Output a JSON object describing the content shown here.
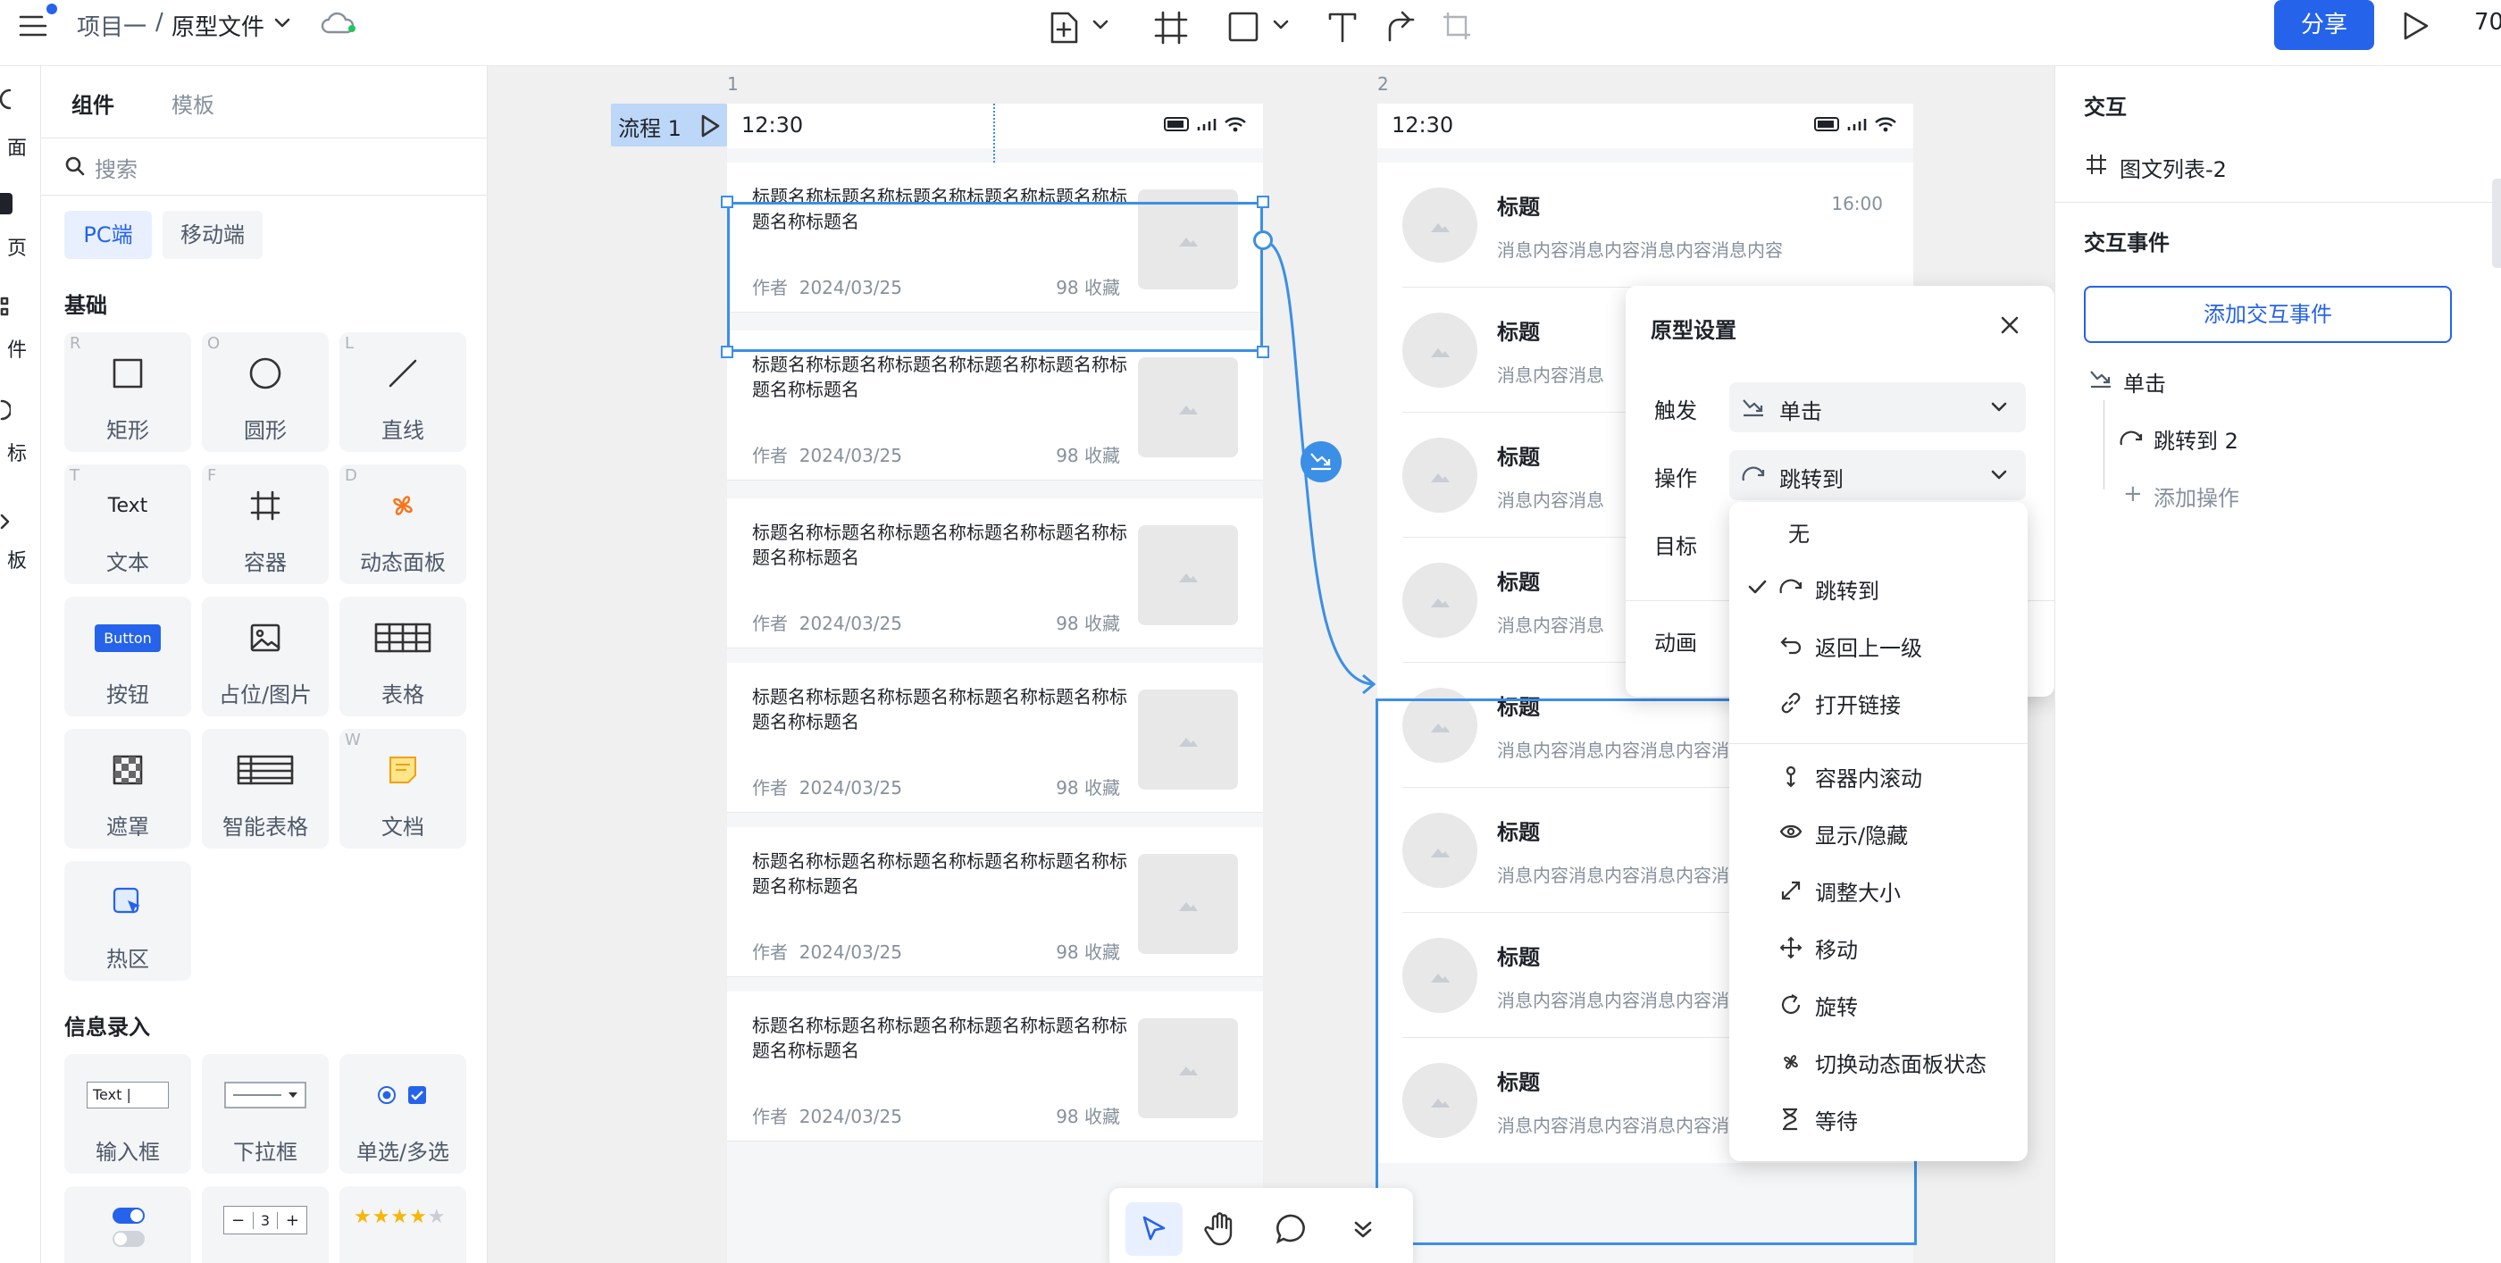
{
  "toolbar": {
    "project": "项目一",
    "separator": "/",
    "file_name": "原型文件",
    "share_label": "分享",
    "zoom": "70"
  },
  "rail": [
    "面",
    "页",
    "件",
    "标",
    "板"
  ],
  "left_panel": {
    "tabs": [
      "组件",
      "模板"
    ],
    "search_placeholder": "搜索",
    "platforms": [
      "PC端",
      "移动端"
    ],
    "section_basic": "基础",
    "basic": [
      {
        "key": "R",
        "label": "矩形",
        "icon": "rectangle-icon"
      },
      {
        "key": "O",
        "label": "圆形",
        "icon": "circle-icon"
      },
      {
        "key": "L",
        "label": "直线",
        "icon": "line-icon"
      },
      {
        "key": "T",
        "label": "文本",
        "glyph": "Text",
        "icon": "text-icon"
      },
      {
        "key": "F",
        "label": "容器",
        "icon": "frame-icon"
      },
      {
        "key": "D",
        "label": "动态面板",
        "icon": "pinwheel-icon"
      },
      {
        "key": "",
        "label": "按钮",
        "glyph": "Button",
        "icon": "button-icon"
      },
      {
        "key": "",
        "label": "占位/图片",
        "icon": "image-icon"
      },
      {
        "key": "",
        "label": "表格",
        "icon": "table-icon"
      },
      {
        "key": "",
        "label": "遮罩",
        "icon": "mask-icon"
      },
      {
        "key": "",
        "label": "智能表格",
        "icon": "smart-table-icon"
      },
      {
        "key": "W",
        "label": "文档",
        "icon": "document-icon"
      },
      {
        "key": "",
        "label": "热区",
        "icon": "hotspot-icon"
      }
    ],
    "section_input": "信息录入",
    "inputs": [
      {
        "label": "输入框",
        "glyph": "Text |"
      },
      {
        "label": "下拉框"
      },
      {
        "label": "单选/多选"
      }
    ],
    "stepper_value": "3"
  },
  "canvas": {
    "frame1_num": "1",
    "frame2_num": "2",
    "flow_label": "流程 1",
    "time": "12:30",
    "card_title": "标题名称标题名称标题名称标题名称标题名称标题名称标题名",
    "card_author": "作者",
    "card_date": "2024/03/25",
    "card_fav": "98 收藏",
    "msg_title": "标题",
    "msg_content": "消息内容消息内容消息内容消息内容",
    "msg_time": "16:00"
  },
  "proto": {
    "title": "原型设置",
    "trigger_label": "触发",
    "trigger_value": "单击",
    "action_label": "操作",
    "action_value": "跳转到",
    "target_label": "目标",
    "anim_label": "动画"
  },
  "menu": [
    {
      "label": "无",
      "icon": "",
      "checked": false
    },
    {
      "label": "跳转到",
      "icon": "jump-icon",
      "checked": true
    },
    {
      "label": "返回上一级",
      "icon": "back-icon",
      "checked": false
    },
    {
      "label": "打开链接",
      "icon": "link-icon",
      "checked": false
    },
    {
      "label": "容器内滚动",
      "icon": "scroll-icon",
      "checked": false
    },
    {
      "label": "显示/隐藏",
      "icon": "eye-icon",
      "checked": false
    },
    {
      "label": "调整大小",
      "icon": "resize-icon",
      "checked": false
    },
    {
      "label": "移动",
      "icon": "move-icon",
      "checked": false
    },
    {
      "label": "旋转",
      "icon": "rotate-icon",
      "checked": false
    },
    {
      "label": "切换动态面板状态",
      "icon": "pinwheel-icon",
      "checked": false
    },
    {
      "label": "等待",
      "icon": "hourglass-icon",
      "checked": false
    }
  ],
  "right_panel": {
    "title": "交互",
    "selected": "图文列表-2",
    "events_title": "交互事件",
    "add_event": "添加交互事件",
    "event_trigger": "单击",
    "event_action": "跳转到 2",
    "add_action": "添加操作"
  },
  "colors": {
    "accent": "#2563eb",
    "canvas": "#f0f0f0",
    "connector": "#3b8fe6"
  }
}
